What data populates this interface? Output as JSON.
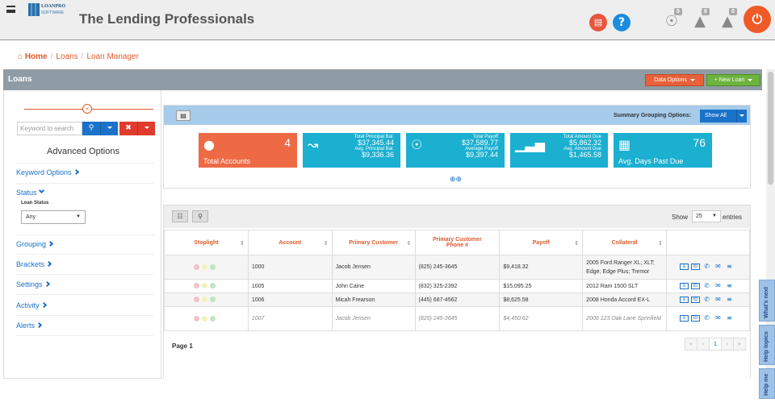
{
  "header": {
    "logo_name": "LOANPRO",
    "logo_sub": "SOFTWARE",
    "title": "The Lending Professionals",
    "badges": {
      "broadcast": "0",
      "announce": "0",
      "notify": "0"
    }
  },
  "breadcrumb": {
    "home": "Home",
    "loans": "Loans",
    "manager": "Loan Manager"
  },
  "bar": {
    "title": "Loans",
    "data_options": "Data Options",
    "new_loan": "+ New Loan"
  },
  "sidebar": {
    "search_placeholder": "Keyword to search",
    "advanced": "Advanced Options",
    "keyword_options": "Keyword Options",
    "status": "Status",
    "loan_status_label": "Loan Status",
    "loan_status_value": "Any",
    "grouping": "Grouping",
    "brackets": "Brackets",
    "settings": "Settings",
    "activity": "Activity",
    "alerts": "Alerts"
  },
  "summary": {
    "grouping_label": "Summary Grouping Options:",
    "show_all": "Show All",
    "cards": {
      "total_accounts": {
        "value": "4",
        "label": "Total Accounts"
      },
      "principal": {
        "l1": "Total Principal Bal.",
        "v1": "$37,345.44",
        "l2": "Avg. Principal Bal.",
        "v2": "$9,336.36"
      },
      "payoff": {
        "l1": "Total Payoff",
        "v1": "$37,589.77",
        "l2": "Average Payoff",
        "v2": "$9,397.44"
      },
      "amount_due": {
        "l1": "Total Amount Due",
        "v1": "$5,862.32",
        "l2": "Avg. Amount Due",
        "v2": "$1,465.58"
      },
      "days_past_due": {
        "value": "76",
        "label": "Avg. Days Past Due"
      }
    }
  },
  "table": {
    "show": "Show",
    "entries_value": "25",
    "entries": "entries",
    "columns": [
      "Stoplight",
      "Account",
      "Primary Customer",
      "Primary Customer Phone #",
      "Payoff",
      "Collateral"
    ],
    "rows": [
      {
        "account": "1000",
        "customer": "Jacob Jensen",
        "phone": "(825) 245-3645",
        "payoff": "$9,418.32",
        "collateral": "2005 Ford Ranger XL; XLT; Edge; Edge Plus; Tremor"
      },
      {
        "account": "1005",
        "customer": "John Caine",
        "phone": "(832) 325-2392",
        "payoff": "$15,095.25",
        "collateral": "2012 Ram 1500 SLT"
      },
      {
        "account": "1006",
        "customer": "Micah Frearson",
        "phone": "(445) 687-4562",
        "payoff": "$8,625.58",
        "collateral": "2008 Honda Accord EX-L"
      },
      {
        "account": "1007",
        "customer": "Jacob Jensen",
        "phone": "(825) 245-3645",
        "payoff": "$4,450.62",
        "collateral": "2006 123 Oak Lane Sprinfield"
      }
    ],
    "page_label": "Page 1",
    "current_page": "1"
  },
  "side_tabs": {
    "whats_next": "What's next",
    "help_topics": "Help topics",
    "help_me": "Help me"
  },
  "colors": {
    "accent": "#e05a2b",
    "primary": "#1a72c9",
    "card_orange": "#ee6a45",
    "card_cyan": "#1bafd0"
  }
}
